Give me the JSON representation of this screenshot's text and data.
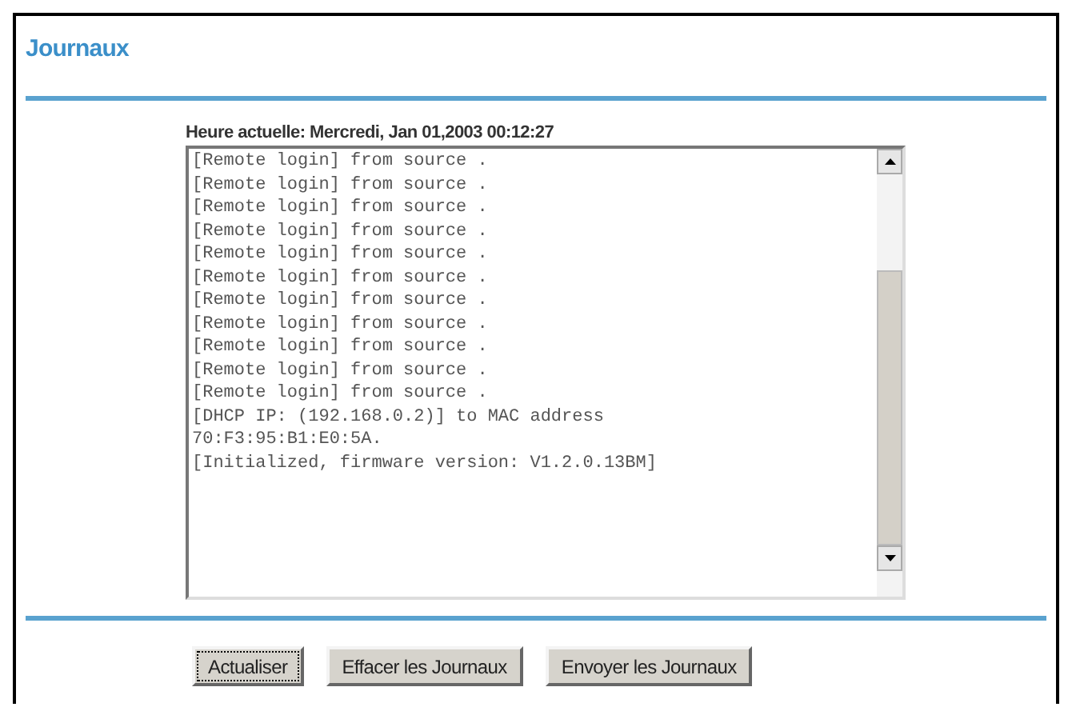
{
  "title": "Journaux",
  "current_time": "Heure actuelle: Mercredi, Jan 01,2003 00:12:27",
  "log_lines": [
    "[Remote login] from source .",
    "[Remote login] from source .",
    "[Remote login] from source .",
    "[Remote login] from source .",
    "[Remote login] from source .",
    "[Remote login] from source .",
    "[Remote login] from source .",
    "[Remote login] from source .",
    "[Remote login] from source .",
    "[Remote login] from source .",
    "[Remote login] from source .",
    "[DHCP IP: (192.168.0.2)] to MAC address",
    "70:F3:95:B1:E0:5A.",
    "[Initialized, firmware version: V1.2.0.13BM]"
  ],
  "buttons": [
    {
      "label": "Actualiser",
      "focused": true
    },
    {
      "label": "Effacer les Journaux",
      "focused": false
    },
    {
      "label": "Envoyer les Journaux",
      "focused": false
    }
  ]
}
